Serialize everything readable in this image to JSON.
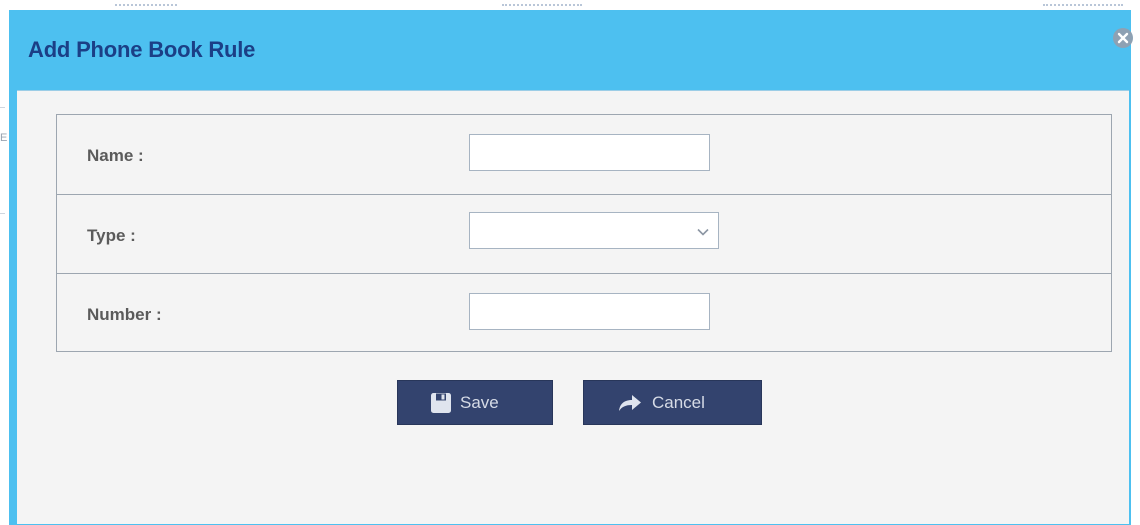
{
  "dialog": {
    "title": "Add Phone Book Rule",
    "close_icon": "close-circle-icon"
  },
  "form": {
    "fields": [
      {
        "label": "Name :",
        "type": "text",
        "value": ""
      },
      {
        "label": "Type :",
        "type": "select",
        "value": ""
      },
      {
        "label": "Number :",
        "type": "text",
        "value": ""
      }
    ]
  },
  "buttons": {
    "save_label": "Save",
    "save_icon": "floppy-disk-icon",
    "cancel_label": "Cancel",
    "cancel_icon": "forward-arrow-icon"
  },
  "colors": {
    "header_bg": "#4dc0f0",
    "title_text": "#1b3f86",
    "body_bg": "#f4f4f4",
    "button_bg": "#33436e",
    "button_text": "#d6dbe6"
  }
}
